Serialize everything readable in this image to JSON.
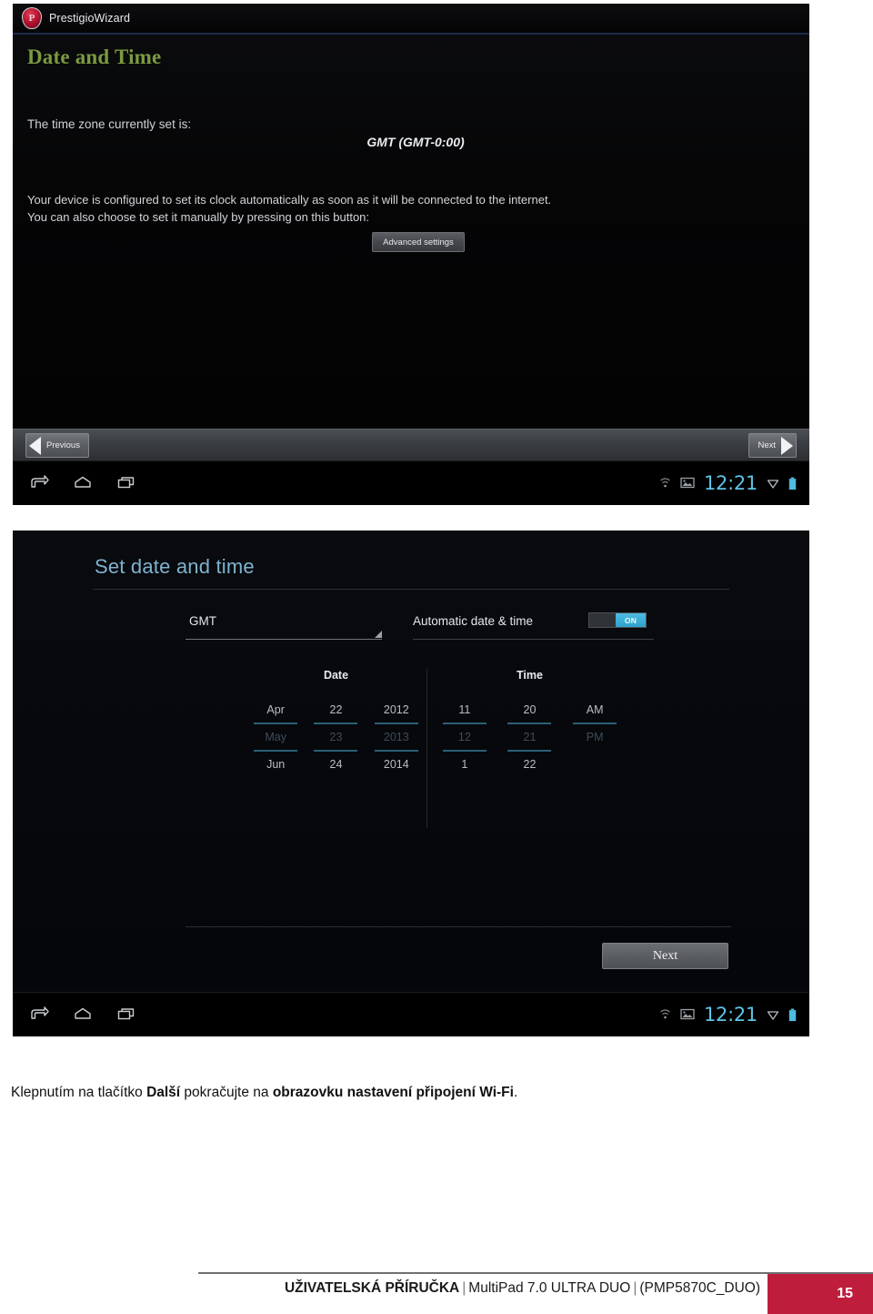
{
  "document": {
    "caption": {
      "part1": "Klepnutím na tlačítko ",
      "bold1": "Další",
      "part2": " pokračujte na ",
      "bold2": "obrazovku nastavení připojení Wi-Fi",
      "part3": "."
    },
    "footer": {
      "manual_label": "UŽIVATELSKÁ PŘÍRUČKA",
      "separator1": "|",
      "device": "MultiPad 7.0 ULTRA DUO",
      "separator2": "|",
      "model": "(PMP5870C_DUO)",
      "page_number": "15",
      "badge_color": "#be1e3c"
    }
  },
  "screenshot_one": {
    "titlebar": {
      "app_name": "PrestigioWizard",
      "logo_glyph": "P"
    },
    "heading": "Date and Time",
    "heading_color": "#7c9a3f",
    "timezone_label": "The time zone currently set is:",
    "timezone_value": "GMT (GMT-0:00)",
    "paragraph_line1": "Your device is configured to set its clock automatically as soon as it will be connected to the internet.",
    "paragraph_line2": "You can also choose to set it manually by pressing on this button:",
    "advanced_button": "Advanced settings",
    "nav": {
      "previous": "Previous",
      "next": "Next"
    },
    "system_bar": {
      "clock": "12:21"
    }
  },
  "screenshot_two": {
    "heading": "Set date and time",
    "heading_color": "#7fb3cf",
    "timezone_spinner_value": "GMT",
    "automatic_label": "Automatic date & time",
    "automatic_state": "ON",
    "automatic_color": "#2fa3cd",
    "picker": {
      "date_title": "Date",
      "time_title": "Time",
      "date_columns": [
        {
          "above": "Apr",
          "selected": "May",
          "below": "Jun"
        },
        {
          "above": "22",
          "selected": "23",
          "below": "24"
        },
        {
          "above": "2012",
          "selected": "2013",
          "below": "2014"
        }
      ],
      "time_columns": [
        {
          "above": "11",
          "selected": "12",
          "below": "1"
        },
        {
          "above": "20",
          "selected": "21",
          "below": "22"
        },
        {
          "above": "AM",
          "selected": "PM",
          "below": ""
        }
      ]
    },
    "next_button": "Next",
    "system_bar": {
      "clock": "12:21"
    }
  }
}
